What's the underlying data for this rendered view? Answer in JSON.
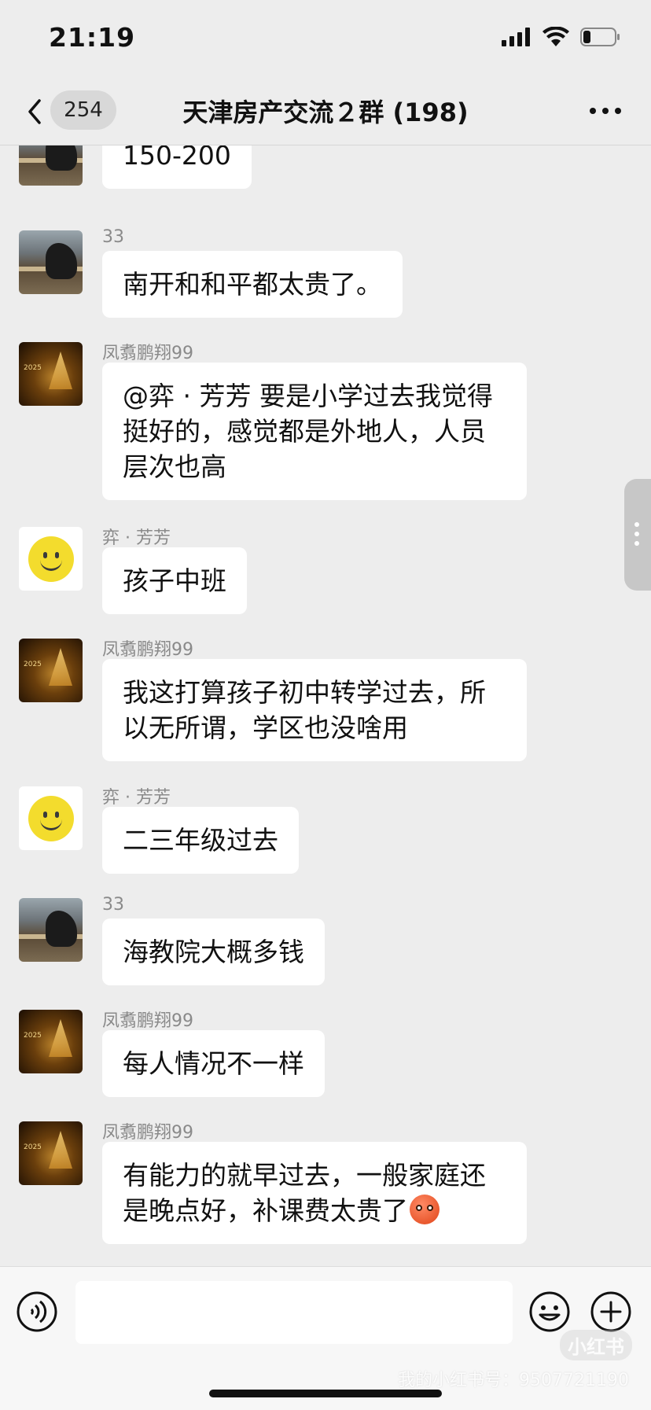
{
  "status_bar": {
    "time": "21:19"
  },
  "nav": {
    "unread_count": "254",
    "title": "天津房产交流２群 (198)"
  },
  "messages": [
    {
      "sender": "",
      "text": "150-200"
    },
    {
      "sender": "33",
      "text": "南开和和平都太贵了。"
    },
    {
      "sender": "凤翥鹏翔99",
      "text": "@弈 · 芳芳 要是小学过去我觉得挺好的，感觉都是外地人，人员层次也高"
    },
    {
      "sender": "弈 · 芳芳",
      "text": "孩子中班"
    },
    {
      "sender": "凤翥鹏翔99",
      "text": "我这打算孩子初中转学过去，所以无所谓，学区也没啥用"
    },
    {
      "sender": "弈 · 芳芳",
      "text": "二三年级过去"
    },
    {
      "sender": "33",
      "text": "海教院大概多钱"
    },
    {
      "sender": "凤翥鹏翔99",
      "text": "每人情况不一样"
    },
    {
      "sender": "凤翥鹏翔99",
      "text": "有能力的就早过去，一般家庭还是晚点好，补课费太贵了"
    }
  ],
  "avatar_ship_text": "2025",
  "icons": {
    "back": "chevron-left-icon",
    "more": "more-dots-icon",
    "voice": "voice-icon",
    "emoji": "emoji-icon",
    "plus": "plus-icon",
    "emoji_inline": "cold-sweat-emoji"
  },
  "watermark": {
    "logo": "小红书",
    "id": "我的小红书号：9507721190"
  }
}
